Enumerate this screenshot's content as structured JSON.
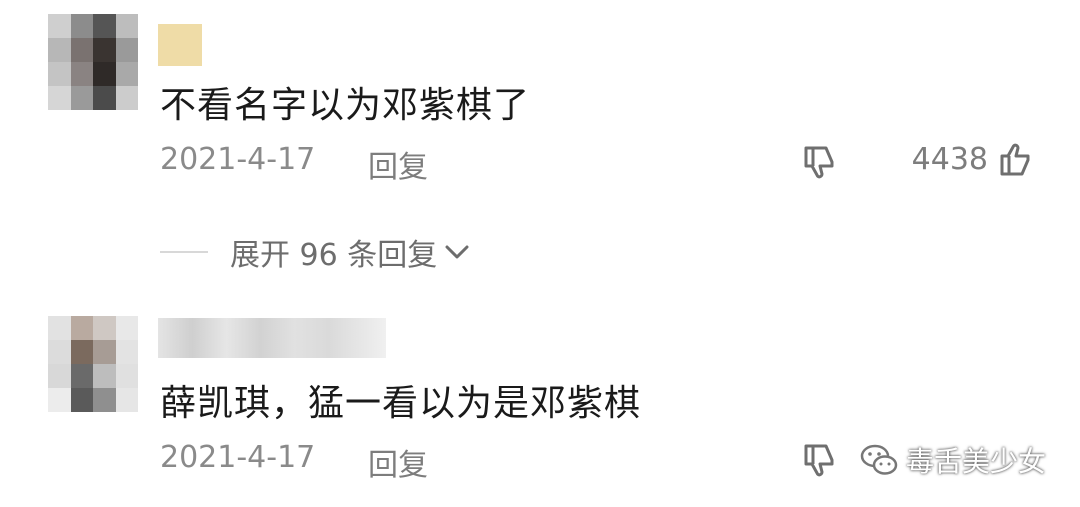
{
  "comments": [
    {
      "text": "不看名字以为邓紫棋了",
      "date": "2021-4-17",
      "reply_label": "回复",
      "like_count": "4438",
      "expand_label": "展开 96 条回复"
    },
    {
      "text": "薛凯琪，猛一看以为是邓紫棋",
      "date": "2021-4-17",
      "reply_label": "回复"
    }
  ],
  "watermark": {
    "text": "毒舌美少女"
  },
  "colors": {
    "background": "#ffffff",
    "text": "#1a1a1a",
    "meta": "#8a8a8a"
  },
  "icons": [
    "thumbs-down-icon",
    "thumbs-up-icon",
    "chevron-down-icon",
    "wechat-icon"
  ]
}
